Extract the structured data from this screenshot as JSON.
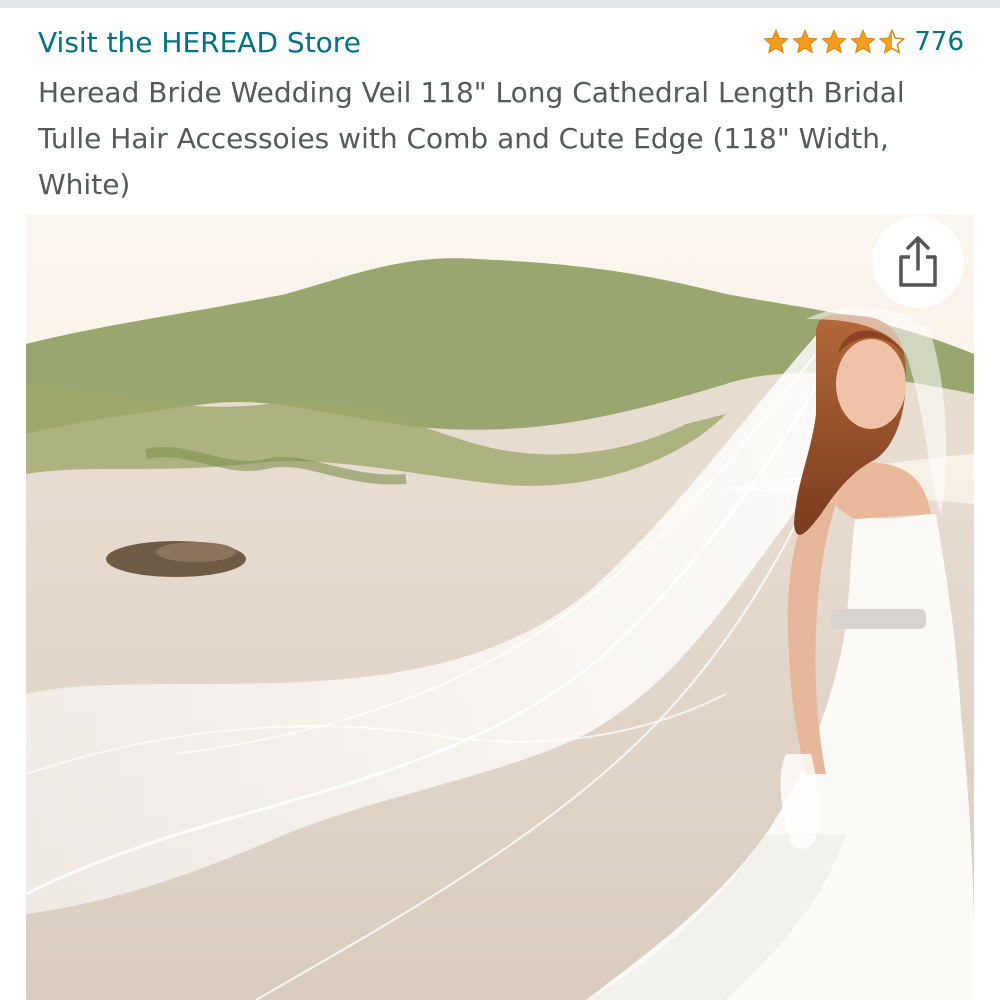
{
  "store": {
    "link_label": "Visit the HEREAD Store"
  },
  "rating": {
    "stars": 4.5,
    "count": "776",
    "star_color": "#f79d1e"
  },
  "product": {
    "title": "Heread Bride Wedding Veil 118\" Long Cathedral Length Bridal Tulle Hair Accessoies with Comb and Cute Edge (118\" Width, White)"
  },
  "image": {
    "description_icon": "product-photo"
  },
  "share": {
    "icon": "share-icon"
  },
  "colors": {
    "link": "#007185",
    "title": "#565959",
    "star": "#f79d1e"
  }
}
